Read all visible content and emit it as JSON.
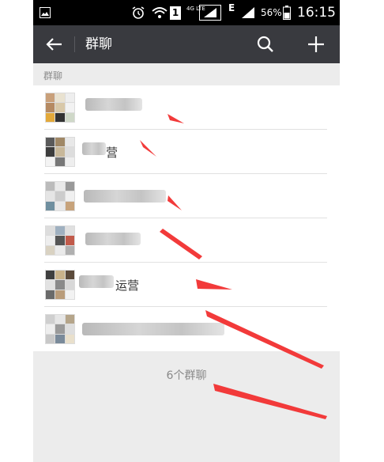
{
  "status_bar": {
    "network_small": "4G LTE",
    "network_e": "E",
    "sim_label": "1",
    "battery_percent": "56%",
    "time": "16:15",
    "icons": [
      "gallery-notification-icon",
      "alarm-icon",
      "wifi-icon",
      "sim-icon",
      "signal-icon",
      "battery-icon"
    ]
  },
  "toolbar": {
    "title": "群聊",
    "icons": [
      "back-arrow-icon",
      "search-icon",
      "plus-icon"
    ]
  },
  "section": {
    "label": "群聊"
  },
  "groups": [
    {
      "name": ""
    },
    {
      "name": "营"
    },
    {
      "name": ""
    },
    {
      "name": ""
    },
    {
      "name": "运营"
    },
    {
      "name": ""
    }
  ],
  "footer": {
    "count_text": "6个群聊"
  },
  "colors": {
    "toolbar_bg": "#393a3f",
    "annotation_arrow": "#f23a3a",
    "list_bg": "#ffffff",
    "page_bg": "#ececec"
  }
}
